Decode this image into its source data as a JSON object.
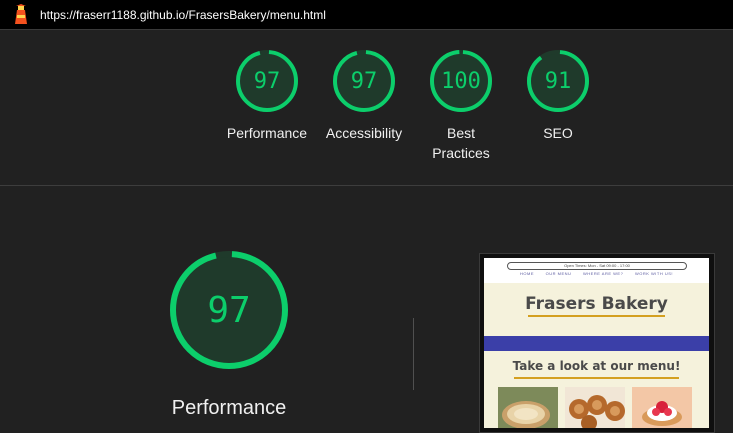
{
  "header": {
    "url": "https://fraserr1188.github.io/FrasersBakery/menu.html",
    "logo_icon": "lighthouse-icon"
  },
  "categories": [
    {
      "score": "97",
      "label": "Performance",
      "fraction": 0.97
    },
    {
      "score": "97",
      "label": "Accessibility",
      "fraction": 0.97
    },
    {
      "score": "100",
      "label": "Best Practices",
      "fraction": 1.0
    },
    {
      "score": "91",
      "label": "SEO",
      "fraction": 0.91
    }
  ],
  "main": {
    "score": "97",
    "label": "Performance",
    "fraction": 0.97
  },
  "colors": {
    "pass": "#0cce6b",
    "pass_bg": "#1f3a2b",
    "background": "#212121"
  },
  "screenshot": {
    "open_times": "Open Times: Mon - Sat 09:00 - 17:00",
    "nav_links": [
      "HOME",
      "OUR MENU",
      "WHERE ARE WE?",
      "WORK WITH US!"
    ],
    "title": "Frasers Bakery",
    "subtitle": "Take a look at our menu!"
  }
}
